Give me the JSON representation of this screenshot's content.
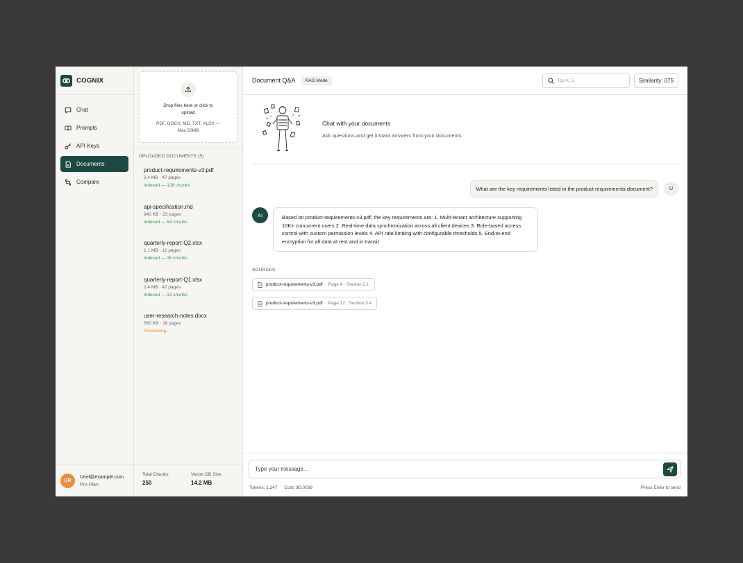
{
  "brand": {
    "name": "COGNIX"
  },
  "nav": [
    {
      "label": "Chat",
      "icon": "chat-icon",
      "active": false
    },
    {
      "label": "Prompts",
      "icon": "book-icon",
      "active": false
    },
    {
      "label": "API Keys",
      "icon": "key-icon",
      "active": false
    },
    {
      "label": "Documents",
      "icon": "document-icon",
      "active": true
    },
    {
      "label": "Compare",
      "icon": "compare-icon",
      "active": false
    }
  ],
  "user": {
    "initials": "UR",
    "email": "Uriel@example.com",
    "plan": "Pro Plan"
  },
  "upload": {
    "text": "Drop files here or click to upload",
    "formats": "PDF, DOCX, MD, TXT, XLSX — Max 50MB"
  },
  "documents": {
    "header": "UPLOADED DOCUMENTS (5)",
    "items": [
      {
        "name": "product-requirements-v3.pdf",
        "meta": "2.4 MB · 47 pages",
        "status": "Indexed — 128 chunks",
        "state": "ok"
      },
      {
        "name": "api-specification.md",
        "meta": "840 KB · 23 pages",
        "status": "Indexed — 64 chunks",
        "state": "ok"
      },
      {
        "name": "quarterly-report-Q2.xlsx",
        "meta": "1.1 MB · 12 pages",
        "status": "Indexed — 36 chunks",
        "state": "ok"
      },
      {
        "name": "quarterly-report-Q1.xlsx",
        "meta": "2.4 MB · 47 pages",
        "status": "Indexed — 33 chunks",
        "state": "ok"
      },
      {
        "name": "user-research-notes.docx",
        "meta": "560 KB · 18 pages",
        "status": "Processing...",
        "state": "processing"
      }
    ]
  },
  "stats": {
    "chunks_label": "Total Chunks",
    "chunks_value": "250",
    "size_label": "Vector DB Size",
    "size_value": "14.2 MB"
  },
  "topbar": {
    "title": "Document Q&A",
    "mode": "RAG Mode",
    "search_placeholder": "Top K: 5",
    "similarity": "Similarity: 075"
  },
  "hero": {
    "title": "Chat with your documents",
    "subtitle": "Ask questions and get instant answers from your documents"
  },
  "messages": {
    "user_text": "What are the key requirements listed in the product requirements document?",
    "user_avatar": "U",
    "ai_avatar": "AI",
    "ai_text": "Based on product-requirements-v3.pdf, the key requirements are: 1. Multi-tenant architecture supporting 10K+ concurrent users 2. Real-time data synchronization across all client devices 3. Role-based access control with custom permission levels 4. API rate limiting with configurable thresholds 5. End-to-end encryption for all data at rest and in transit"
  },
  "sources": {
    "label": "SOURCES",
    "items": [
      {
        "file": "product-requirements-v3.pdf",
        "location": "· Page 4 · Section 2.1"
      },
      {
        "file": "product-requirements-v3.pdf",
        "location": "· Page 12 · Section 3.4"
      }
    ]
  },
  "composer": {
    "placeholder": "Type your message...",
    "tokens": "Tokens: 1,247",
    "cost": "Cost: $0.0038",
    "hint": "Press Enter to send"
  },
  "colors": {
    "accent": "#1c4a40",
    "success": "#2f9a52",
    "warning": "#e08a27",
    "avatar": "#e98f3b"
  }
}
